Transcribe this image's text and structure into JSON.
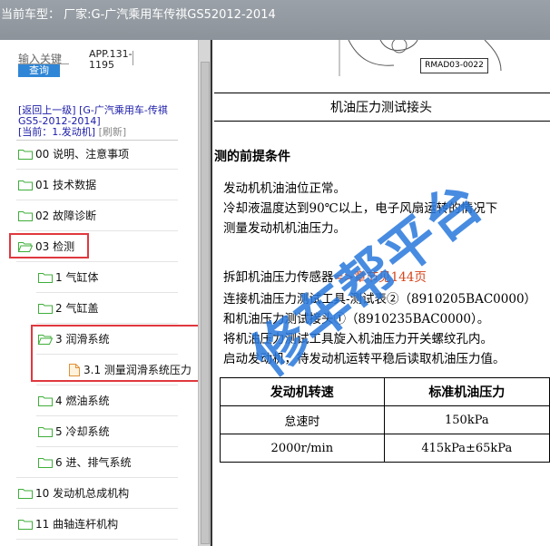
{
  "titlebar": {
    "text": "当前车型： 厂家:G-广汽乘用车传祺GS52012-2014"
  },
  "search": {
    "placeholder": "输入关键",
    "button": "查询",
    "app_id": "APP.131-1195"
  },
  "nav": {
    "back": "[返回上一级]",
    "path": "[G-广汽乘用车-传祺GS5-2012-2014]",
    "current": "[当前：1.发动机]",
    "refresh": "[刷新]"
  },
  "tree": [
    {
      "label": "00 说明、注意事项",
      "type": "folder"
    },
    {
      "label": "01 技术数据",
      "type": "folder"
    },
    {
      "label": "02 故障诊断",
      "type": "folder"
    },
    {
      "label": "03 检测",
      "type": "folder",
      "highlighted": true
    },
    {
      "label": "1 气缸体",
      "type": "folder"
    },
    {
      "label": "2 气缸盖",
      "type": "folder"
    },
    {
      "label": "3 润滑系统",
      "type": "folder",
      "highlighted": true
    },
    {
      "label": "3.1 测量润滑系统压力",
      "type": "doc",
      "highlighted": true
    },
    {
      "label": "4 燃油系统",
      "type": "folder"
    },
    {
      "label": "5 冷却系统",
      "type": "folder"
    },
    {
      "label": "6 进、排气系统",
      "type": "folder"
    },
    {
      "label": "10 发动机总成机构",
      "type": "folder"
    },
    {
      "label": "11 曲轴连杆机构",
      "type": "folder"
    }
  ],
  "document": {
    "figure_label": "RMAD03-0022",
    "title": "机油压力测试接头",
    "section": "测的前提条件",
    "lines": [
      "发动机机油油位正常。",
      "冷却液温度达到90℃以上，电子风扇运转的情况下",
      "测量发动机机油压力。",
      "拆卸机油压力传感器",
      "=>章节见144页",
      "连接机油压力测试工具-测试表②（8910205BAC0000）",
      "和机油压力测试接头①（8910235BAC0000）。",
      "将机油压力测试工具旋入机油压力开关螺纹孔内。",
      "启动发动机，待发动机运转平稳后读取机油压力值。"
    ],
    "table": {
      "headers": [
        "发动机转速",
        "标准机油压力"
      ],
      "rows": [
        [
          "怠速时",
          "150kPa"
        ],
        [
          "2000r/min",
          "415kPa±65kPa"
        ]
      ]
    },
    "watermark": "修车帮平台"
  },
  "colors": {
    "titlebar": "#8f969d",
    "button": "#2f86d6",
    "highlight": "#e0383e",
    "folder": "#3fae3a",
    "link": "#d4451a"
  }
}
